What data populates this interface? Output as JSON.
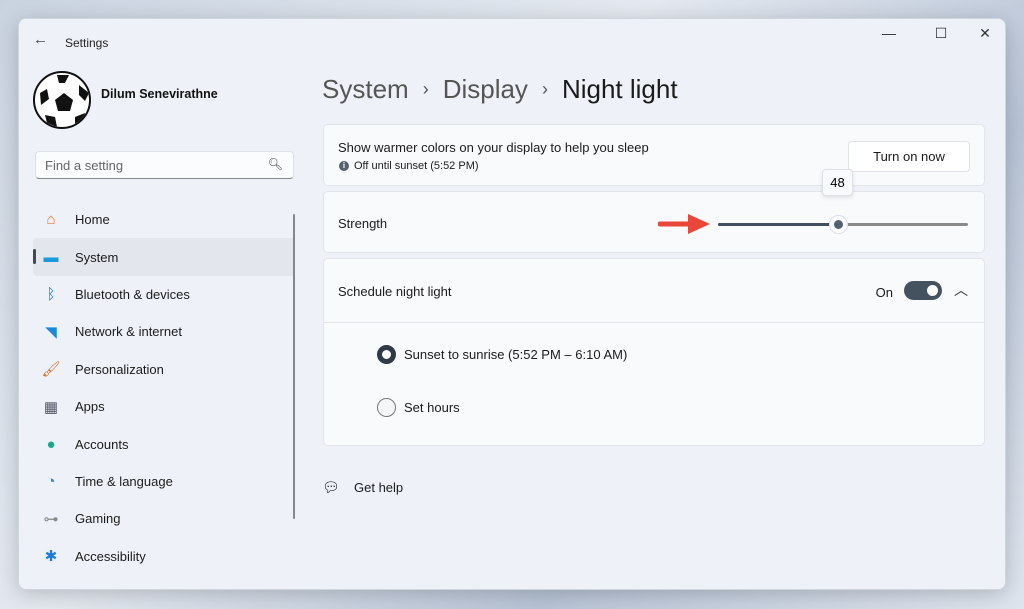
{
  "window": {
    "title": "Settings"
  },
  "user": {
    "name": "Dilum Senevirathne"
  },
  "search": {
    "placeholder": "Find a setting"
  },
  "nav": [
    {
      "label": "Home",
      "icon": "home-icon",
      "color": "#e8742a"
    },
    {
      "label": "System",
      "icon": "system-icon",
      "color": "#1a9ad6"
    },
    {
      "label": "Bluetooth & devices",
      "icon": "bluetooth-icon",
      "color": "#1a73e8"
    },
    {
      "label": "Network & internet",
      "icon": "wifi-icon",
      "color": "#1a8ad6"
    },
    {
      "label": "Personalization",
      "icon": "brush-icon",
      "color": "#e07030"
    },
    {
      "label": "Apps",
      "icon": "apps-icon",
      "color": "#556"
    },
    {
      "label": "Accounts",
      "icon": "accounts-icon",
      "color": "#1aa88a"
    },
    {
      "label": "Time & language",
      "icon": "clock-globe-icon",
      "color": "#2a8ad6"
    },
    {
      "label": "Gaming",
      "icon": "gamepad-icon",
      "color": "#888"
    },
    {
      "label": "Accessibility",
      "icon": "accessibility-icon",
      "color": "#1a7ad6"
    }
  ],
  "breadcrumb": {
    "items": [
      "System",
      "Display"
    ],
    "current": "Night light"
  },
  "night": {
    "description": "Show warmer colors on your display to help you sleep",
    "status": "Off until sunset (5:52 PM)",
    "button": "Turn on now"
  },
  "strength": {
    "label": "Strength",
    "value": 48,
    "value_text": "48"
  },
  "schedule": {
    "label": "Schedule night light",
    "state": "On",
    "options": [
      {
        "label": "Sunset to sunrise (5:52 PM – 6:10 AM)",
        "selected": true
      },
      {
        "label": "Set hours",
        "selected": false
      }
    ]
  },
  "help": {
    "label": "Get help"
  }
}
